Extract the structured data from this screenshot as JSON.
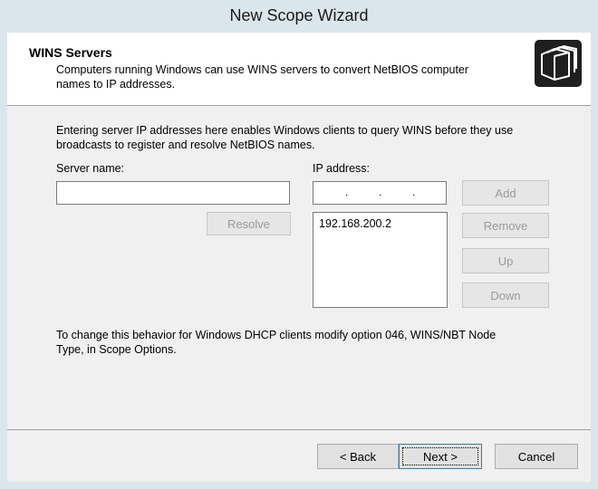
{
  "window": {
    "title": "New Scope Wizard"
  },
  "header": {
    "title": "WINS Servers",
    "subtitle": "Computers running Windows can use WINS servers to convert NetBIOS computer names to IP addresses.",
    "icon": "folders-icon"
  },
  "intro_text": "Entering server IP addresses here enables Windows clients to query WINS before they use broadcasts to register and resolve NetBIOS names.",
  "server_name": {
    "label": "Server name:",
    "value": ""
  },
  "ip_address": {
    "label": "IP address:",
    "separators": [
      ".",
      ".",
      "."
    ]
  },
  "buttons": {
    "resolve": "Resolve",
    "add": "Add",
    "remove": "Remove",
    "up": "Up",
    "down": "Down",
    "back": "< Back",
    "next": "Next >",
    "cancel": "Cancel"
  },
  "ip_list": [
    "192.168.200.2"
  ],
  "footer_text": "To change this behavior for Windows DHCP clients modify option 046, WINS/NBT Node Type, in Scope Options."
}
